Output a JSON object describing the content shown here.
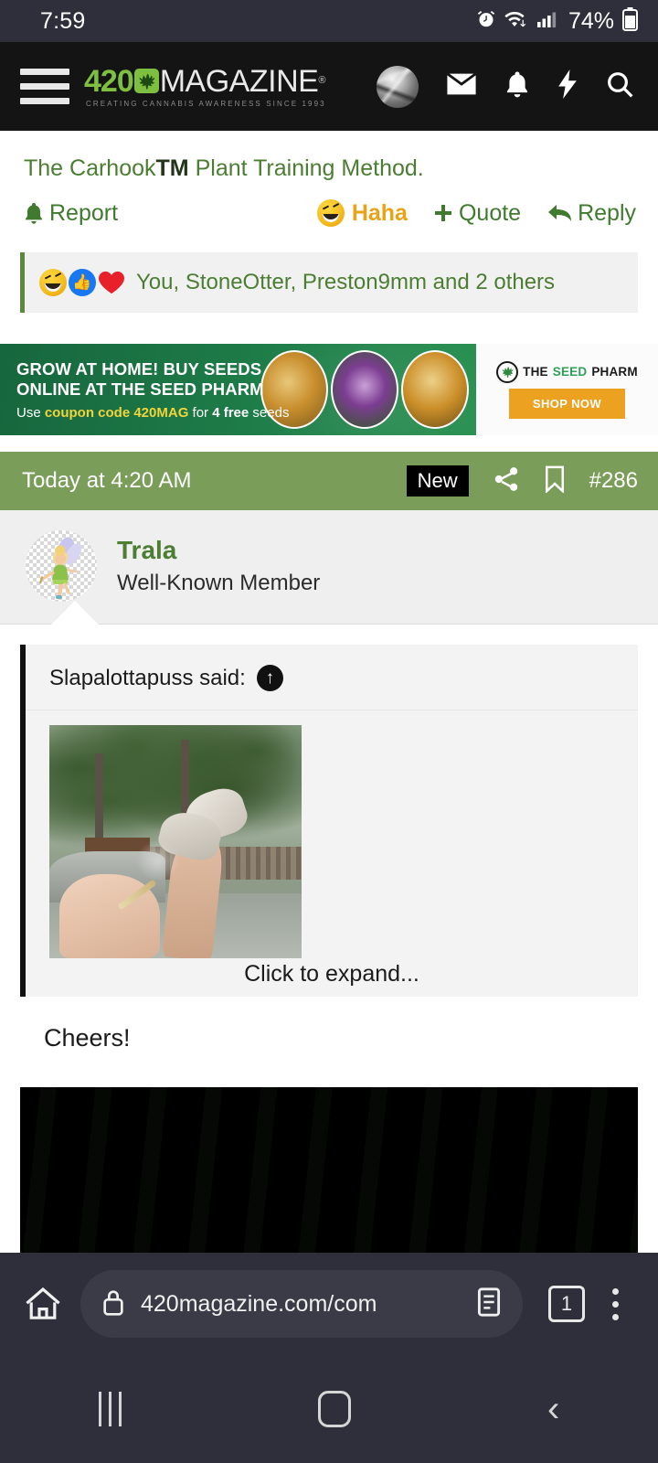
{
  "status_bar": {
    "time": "7:59",
    "battery_pct": "74%",
    "icons": [
      "alarm-icon",
      "wifi-icon",
      "cellular-signal-icon",
      "battery-icon"
    ]
  },
  "site_header": {
    "menu_icon": "hamburger-menu-icon",
    "logo": {
      "number": "420",
      "word": "MAGAZINE",
      "registered": "®",
      "tagline": "CREATING CANNABIS AWARENESS SINCE 1993"
    },
    "icons": [
      "user-avatar",
      "inbox-icon",
      "alerts-bell-icon",
      "whats-new-bolt-icon",
      "search-icon"
    ]
  },
  "post_top": {
    "title_prefix": "The Carhook",
    "title_tm": "TM",
    "title_suffix": " Plant Training Method.",
    "actions": {
      "report": "Report",
      "reaction": "Haha",
      "quote": "Quote",
      "reply": "Reply"
    },
    "reactions": {
      "emoji": [
        "rofl-emoji",
        "like-emoji",
        "love-heart-emoji"
      ],
      "names": "You, StoneOtter, Preston9mm and 2 others"
    }
  },
  "ad": {
    "headline_line1": "GROW AT HOME! BUY SEEDS",
    "headline_line2": "ONLINE AT THE SEED PHARM",
    "sub_pre": "Use ",
    "sub_code": "coupon code 420MAG",
    "sub_mid": " for ",
    "sub_bold": "4 free",
    "sub_post": " seeds",
    "brand_the": "THE ",
    "brand_seed": "SEED",
    "brand_pharm": "PHARM",
    "cta": "SHOP NOW"
  },
  "post": {
    "date": "Today at 4:20 AM",
    "new_badge": "New",
    "share_icon": "share-icon",
    "bookmark_icon": "bookmark-icon",
    "post_number": "#286",
    "author": {
      "name": "Trala",
      "title": "Well-Known Member",
      "avatar": "tinkerbell-fairy-avatar"
    },
    "quote": {
      "attribution": "Slapalottapuss said:",
      "jump_icon": "jump-to-post-arrow-icon",
      "image": "legs-and-joint-outdoor-photo",
      "expand_label": "Click to expand..."
    },
    "body_text": "Cheers!",
    "attachment": "dark-video-thumbnail"
  },
  "browser_bar": {
    "home_icon": "home-icon",
    "lock_icon": "https-lock-icon",
    "url": "420magazine.com/com",
    "reader_icon": "reader-mode-icon",
    "tab_count": "1",
    "menu_icon": "overflow-menu-icon"
  },
  "android_nav": {
    "recents": "recents-icon",
    "home": "home-button-icon",
    "back": "back-button-icon"
  },
  "colors": {
    "brand_green": "#4b7d32",
    "bar_green": "#7a9e5a",
    "accent_gold": "#e8a317",
    "header_dark": "#141414",
    "system_chrome": "#2f2f3b"
  }
}
